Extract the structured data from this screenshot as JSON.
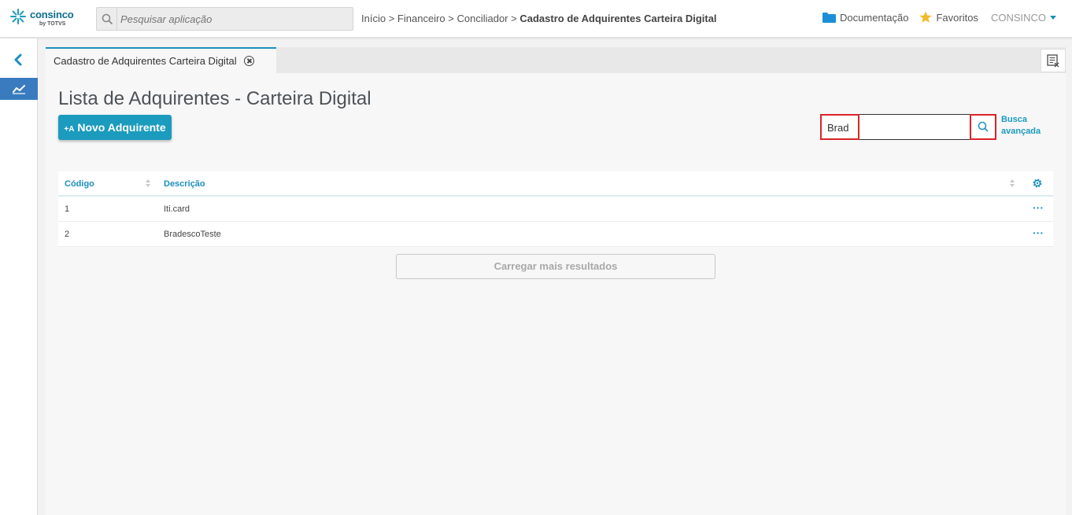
{
  "header": {
    "logo_text": "consinco",
    "logo_sub": "by TOTVS",
    "search_placeholder": "Pesquisar aplicação",
    "breadcrumb": {
      "items": [
        "Início",
        "Financeiro",
        "Conciliador"
      ],
      "separator": ">",
      "current": "Cadastro de Adquirentes Carteira Digital"
    },
    "documentation_label": "Documentação",
    "favorites_label": "Favoritos",
    "user_label": "CONSINCO"
  },
  "tabs": [
    {
      "label": "Cadastro de Adquirentes Carteira Digital",
      "active": true
    }
  ],
  "main": {
    "title": "Lista de Adquirentes - Carteira Digital",
    "new_button_icon": "+A",
    "new_button_label": "Novo Adquirente",
    "search_value": "Brad",
    "advanced_search_line1": "Busca",
    "advanced_search_line2": "avançada",
    "table": {
      "columns": [
        "Código",
        "Descrição"
      ],
      "rows": [
        {
          "code": "1",
          "description": "Iti.card"
        },
        {
          "code": "2",
          "description": "BradescoTeste"
        }
      ],
      "row_actions": "···"
    },
    "load_more_label": "Carregar mais resultados"
  },
  "colors": {
    "accent": "#1b9bbd",
    "highlight": "#d9232a",
    "sidebar_active": "#3a7bc0"
  },
  "icons": {
    "logo": "consinco-logo-icon",
    "search": "search-icon",
    "folder": "folder-icon",
    "star": "star-icon",
    "back": "chevron-left-icon",
    "chart": "chart-line-icon",
    "close": "close-circle-icon",
    "tool": "clear-list-icon",
    "gear": "gear-icon",
    "more": "more-icon"
  }
}
